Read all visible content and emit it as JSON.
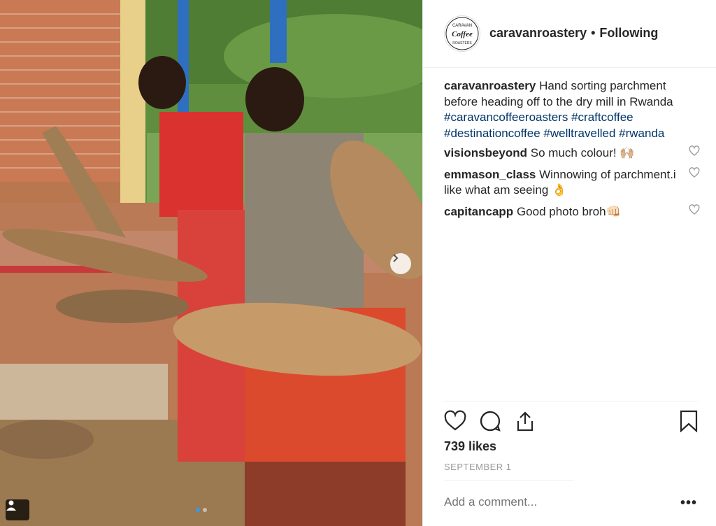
{
  "post": {
    "username": "caravanroastery",
    "separator": "•",
    "follow_status": "Following",
    "avatar_text_top": "CARAVAN",
    "avatar_text_mid": "Coffee",
    "avatar_text_bottom": "ROASTERS"
  },
  "caption": {
    "username": "caravanroastery",
    "text": "Hand sorting parchment before heading off to the dry mill in Rwanda",
    "hashtags": [
      "#caravancoffeeroasters",
      "#craftcoffee",
      "#destinationcoffee",
      "#welltravelled",
      "#rwanda"
    ]
  },
  "comments": [
    {
      "username": "visionsbeyond",
      "text": "So much colour! 🙌🏼"
    },
    {
      "username": "emmason_class",
      "text": "Winnowing of parchment.i like what am seeing 👌"
    },
    {
      "username": "capitancapp",
      "text": "Good photo broh👊🏻"
    }
  ],
  "likes": "739 likes",
  "date": "SEPTEMBER 1",
  "add_comment_placeholder": "Add a comment...",
  "more_label": "•••",
  "icons": {
    "like": "heart-icon",
    "comment": "comment-icon",
    "share": "share-icon",
    "save": "bookmark-icon",
    "next": "chevron-right-icon",
    "tags": "user-tag-icon"
  },
  "colors": {
    "hashtag": "#003569",
    "date": "#999999",
    "active_dot": "#3897f0"
  }
}
